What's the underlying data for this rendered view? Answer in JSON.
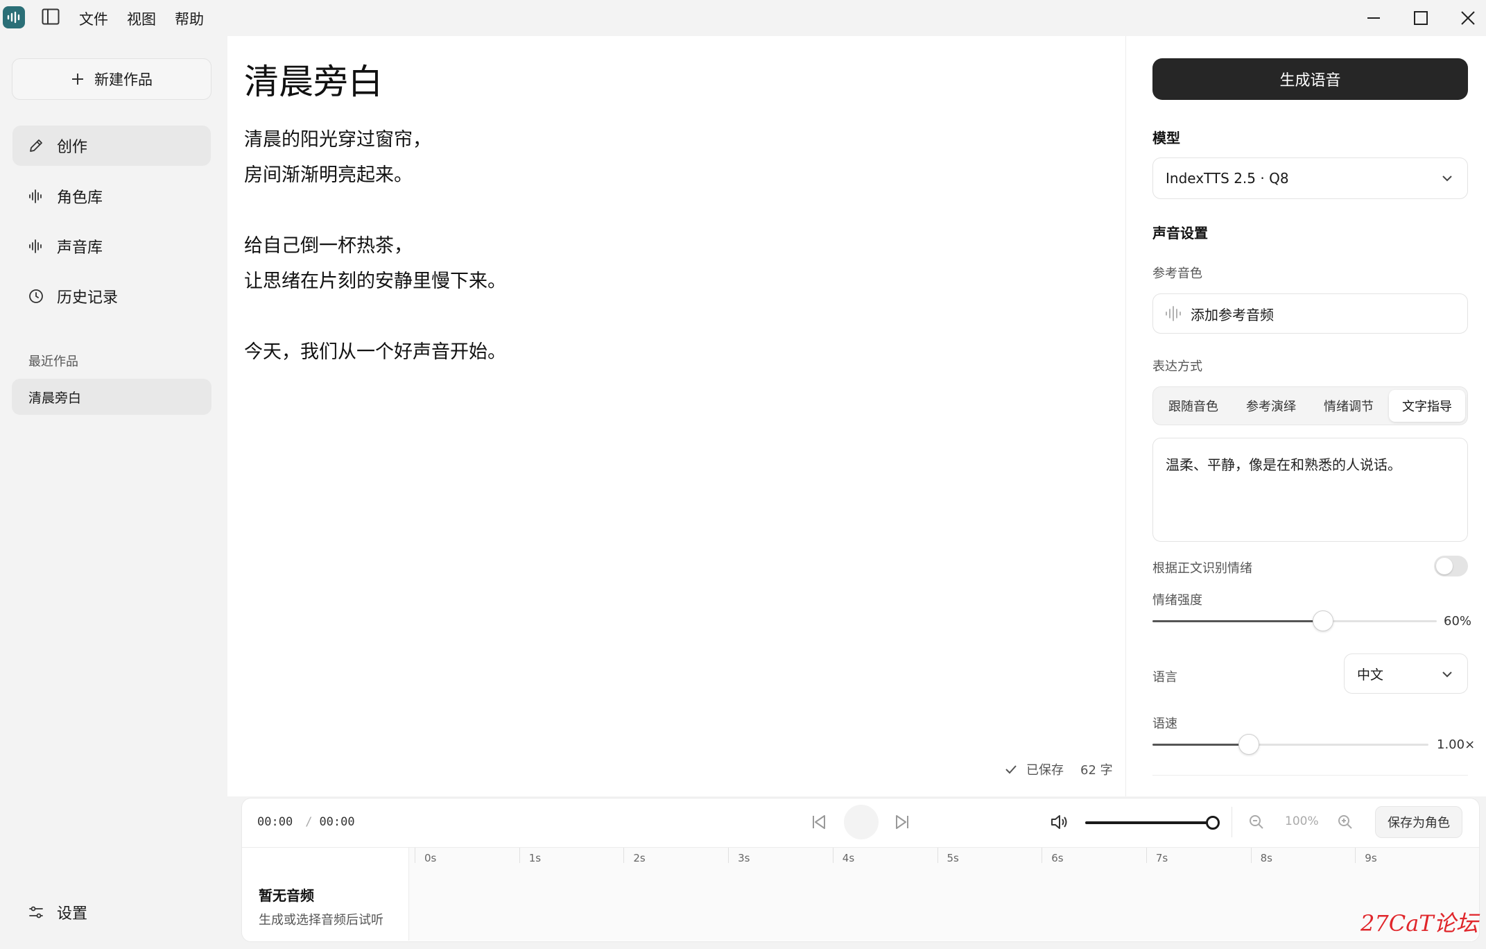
{
  "titlebar": {
    "menu": [
      "文件",
      "视图",
      "帮助"
    ]
  },
  "sidebar": {
    "new_work": "新建作品",
    "nav": [
      {
        "label": "创作",
        "icon": "pencil-icon"
      },
      {
        "label": "角色库",
        "icon": "waveform-icon"
      },
      {
        "label": "声音库",
        "icon": "waveform-icon"
      },
      {
        "label": "历史记录",
        "icon": "clock-icon"
      }
    ],
    "recent_title": "最近作品",
    "recent_items": [
      "清晨旁白"
    ],
    "settings": "设置"
  },
  "editor": {
    "title": "清晨旁白",
    "lines": [
      "清晨的阳光穿过窗帘，",
      "房间渐渐明亮起来。",
      "",
      "给自己倒一杯热茶，",
      "让思绪在片刻的安静里慢下来。",
      "",
      "今天，我们从一个好声音开始。"
    ],
    "saved": "已保存",
    "char_count": "62 字"
  },
  "panel": {
    "generate_button": "生成语音",
    "model_label": "模型",
    "model_value": "IndexTTS 2.5 · Q8",
    "voice_settings": "声音设置",
    "ref_timbre_label": "参考音色",
    "add_ref_audio": "添加参考音频",
    "expression_label": "表达方式",
    "expression_tabs": [
      "跟随音色",
      "参考演绎",
      "情绪调节",
      "文字指导"
    ],
    "expression_active": 3,
    "instruction_text": "温柔、平静，像是在和熟悉的人说话。",
    "auto_emotion_label": "根据正文识别情绪",
    "auto_emotion_on": false,
    "emotion_strength_label": "情绪强度",
    "emotion_strength_value": "60%",
    "emotion_strength": 0.6,
    "language_label": "语言",
    "language_value": "中文",
    "speed_label": "语速",
    "speed_value": "1.00×",
    "speed": 0.35
  },
  "player": {
    "current_time": "00:00",
    "separator": "/",
    "total_time": "00:00",
    "volume": 1.0,
    "zoom": "100%",
    "save_role": "保存为角色",
    "empty_title": "暂无音频",
    "empty_hint": "生成或选择音频后试听",
    "ticks": [
      "0s",
      "1s",
      "2s",
      "3s",
      "4s",
      "5s",
      "6s",
      "7s",
      "8s",
      "9s"
    ]
  },
  "watermark": "27CaT论坛",
  "colors": {
    "primary_button": "#262626",
    "accent_dark": "#1a1a1a",
    "watermark": "#e0262b"
  }
}
